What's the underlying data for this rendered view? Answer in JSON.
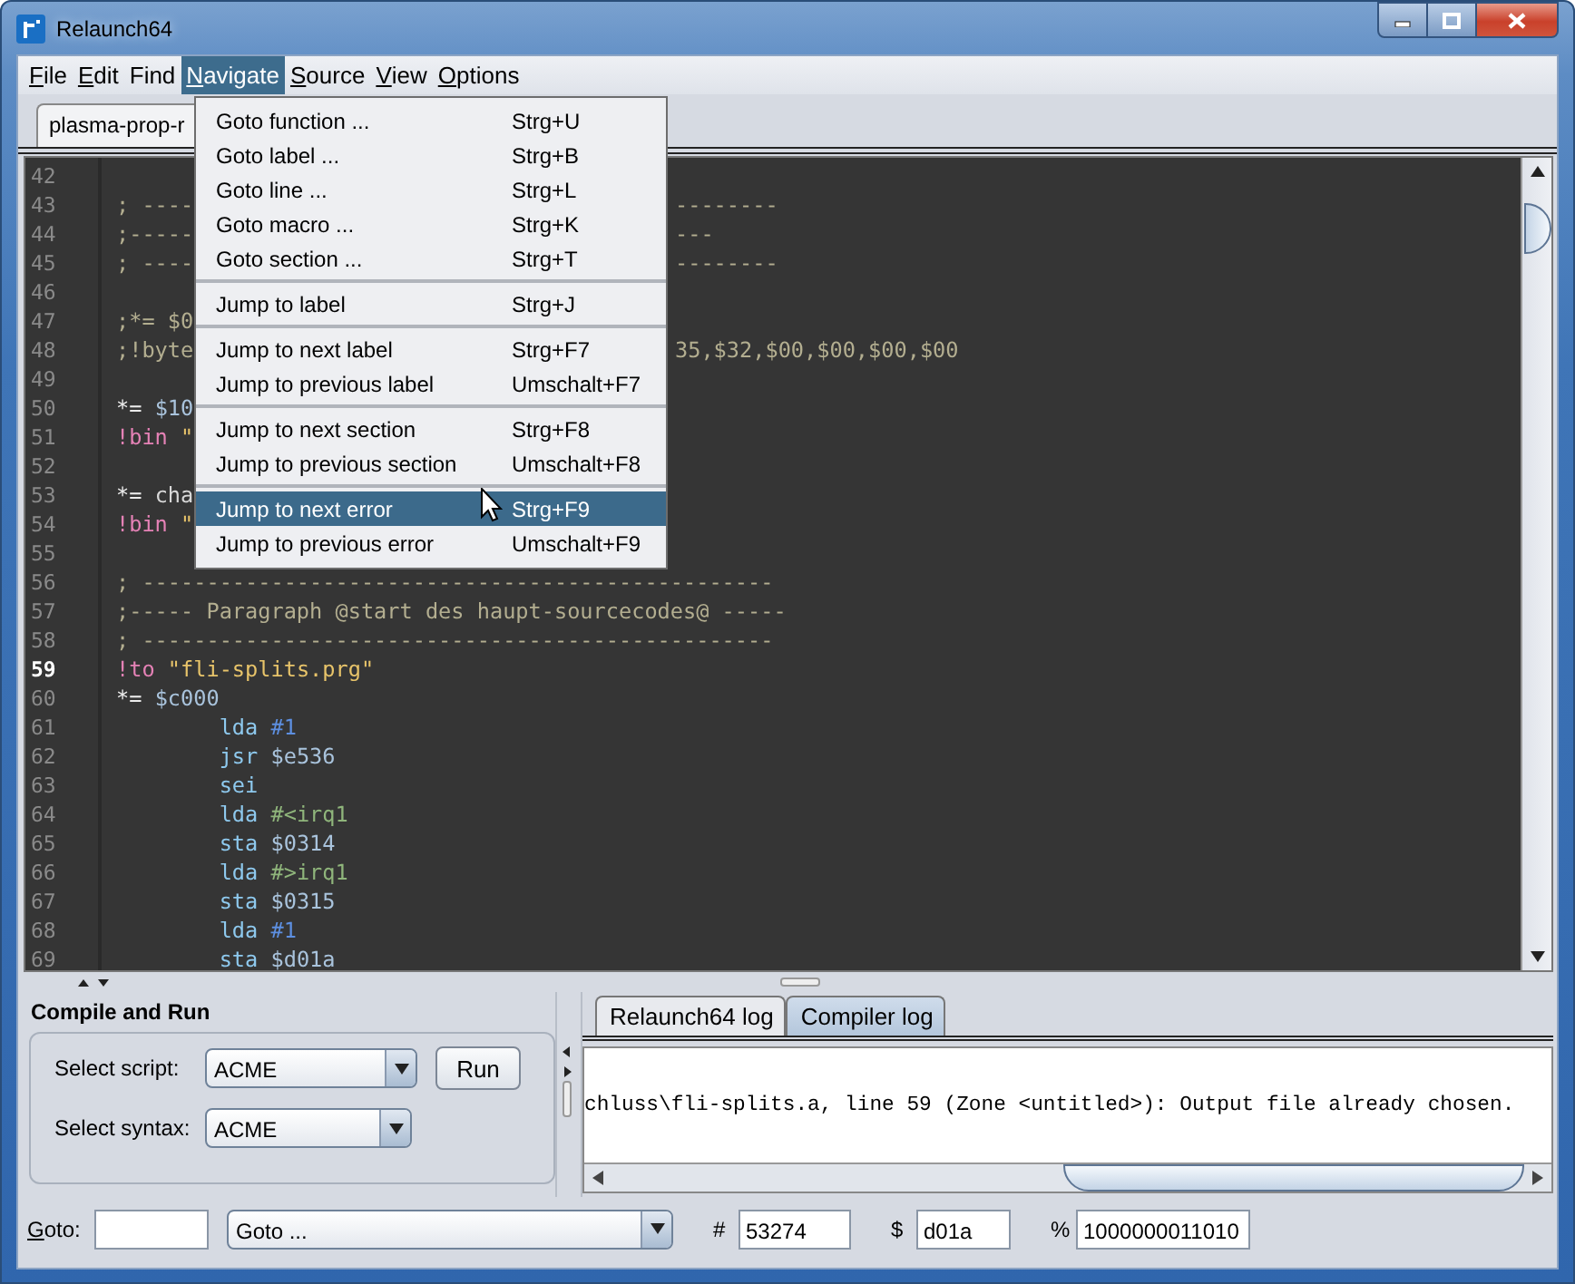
{
  "window": {
    "title": "Relaunch64"
  },
  "menu_bar": [
    {
      "label": "File",
      "first_letter_underlined": true,
      "selected": false
    },
    {
      "label": "Edit",
      "first_letter_underlined": true,
      "selected": false
    },
    {
      "label": "Find",
      "first_letter_underlined": false,
      "selected": false
    },
    {
      "label": "Navigate",
      "first_letter_underlined": true,
      "selected": true
    },
    {
      "label": "Source",
      "first_letter_underlined": true,
      "selected": false
    },
    {
      "label": "View",
      "first_letter_underlined": true,
      "selected": false
    },
    {
      "label": "Options",
      "first_letter_underlined": true,
      "selected": false
    }
  ],
  "open_menu": {
    "items": [
      {
        "kind": "item",
        "label": "Goto function ...",
        "shortcut": "Strg+U",
        "selected": false
      },
      {
        "kind": "item",
        "label": "Goto label ...",
        "shortcut": "Strg+B",
        "selected": false
      },
      {
        "kind": "item",
        "label": "Goto line ...",
        "shortcut": "Strg+L",
        "selected": false
      },
      {
        "kind": "item",
        "label": "Goto macro ...",
        "shortcut": "Strg+K",
        "selected": false
      },
      {
        "kind": "item",
        "label": "Goto section ...",
        "shortcut": "Strg+T",
        "selected": false
      },
      {
        "kind": "separator"
      },
      {
        "kind": "item",
        "label": "Jump to label",
        "shortcut": "Strg+J",
        "selected": false
      },
      {
        "kind": "separator"
      },
      {
        "kind": "item",
        "label": "Jump to next label",
        "shortcut": "Strg+F7",
        "selected": false
      },
      {
        "kind": "item",
        "label": "Jump to previous label",
        "shortcut": "Umschalt+F7",
        "selected": false
      },
      {
        "kind": "separator"
      },
      {
        "kind": "item",
        "label": "Jump to next section",
        "shortcut": "Strg+F8",
        "selected": false
      },
      {
        "kind": "item",
        "label": "Jump to previous section",
        "shortcut": "Umschalt+F8",
        "selected": false
      },
      {
        "kind": "separator"
      },
      {
        "kind": "item",
        "label": "Jump to next error",
        "shortcut": "Strg+F9",
        "selected": true
      },
      {
        "kind": "item",
        "label": "Jump to previous error",
        "shortcut": "Umschalt+F9",
        "selected": false
      }
    ]
  },
  "editor_tabs": [
    {
      "label": "plasma-prop-r"
    }
  ],
  "editor": {
    "lines": [
      {
        "number": "42",
        "current": false
      },
      {
        "number": "43",
        "current": false,
        "tokens": [
          {
            "kind": "comment",
            "text": "; ----"
          }
        ],
        "right": [
          {
            "kind": "comment",
            "text": "--------"
          }
        ]
      },
      {
        "number": "44",
        "current": false,
        "tokens": [
          {
            "kind": "comment",
            "text": ";-----"
          }
        ],
        "right": [
          {
            "kind": "comment",
            "text": "---"
          }
        ]
      },
      {
        "number": "45",
        "current": false,
        "tokens": [
          {
            "kind": "comment",
            "text": "; ----"
          }
        ],
        "right": [
          {
            "kind": "comment",
            "text": "--------"
          }
        ]
      },
      {
        "number": "46",
        "current": false
      },
      {
        "number": "47",
        "current": false,
        "tokens": [
          {
            "kind": "comment",
            "text": ";*= $0"
          }
        ]
      },
      {
        "number": "48",
        "current": false,
        "tokens": [
          {
            "kind": "comment",
            "text": ";!byte"
          }
        ],
        "right": [
          {
            "kind": "comment",
            "text": "35,$32,$00,$00,$00,$00"
          }
        ]
      },
      {
        "number": "49",
        "current": false
      },
      {
        "number": "50",
        "current": false,
        "tokens": [
          {
            "kind": "operator",
            "text": "*="
          },
          {
            "kind": "address",
            "text": " $10"
          }
        ]
      },
      {
        "number": "51",
        "current": false,
        "tokens": [
          {
            "kind": "directive",
            "text": "!bin"
          },
          {
            "kind": "string",
            "text": " \""
          }
        ]
      },
      {
        "number": "52",
        "current": false
      },
      {
        "number": "53",
        "current": false,
        "tokens": [
          {
            "kind": "operator",
            "text": "*="
          },
          {
            "kind": "plain",
            "text": " cha"
          }
        ]
      },
      {
        "number": "54",
        "current": false,
        "tokens": [
          {
            "kind": "directive",
            "text": "!bin"
          },
          {
            "kind": "string",
            "text": " \""
          }
        ]
      },
      {
        "number": "55",
        "current": false
      },
      {
        "number": "56",
        "current": false,
        "tokens": [
          {
            "kind": "comment",
            "text": "; -------------------------------------------------"
          }
        ]
      },
      {
        "number": "57",
        "current": false,
        "tokens": [
          {
            "kind": "comment",
            "text": ";----- Paragraph @start des haupt-sourcecodes@ -----"
          }
        ]
      },
      {
        "number": "58",
        "current": false,
        "tokens": [
          {
            "kind": "comment",
            "text": "; -------------------------------------------------"
          }
        ]
      },
      {
        "number": "59",
        "current": true,
        "tokens": [
          {
            "kind": "directive",
            "text": "!to"
          },
          {
            "kind": "string",
            "text": " \"fli-splits.prg\""
          }
        ]
      },
      {
        "number": "60",
        "current": false,
        "tokens": [
          {
            "kind": "operator",
            "text": "*="
          },
          {
            "kind": "address",
            "text": " $c000"
          }
        ]
      },
      {
        "number": "61",
        "current": false,
        "tokens": [
          {
            "kind": "mnemonic",
            "text": "        lda"
          },
          {
            "kind": "immediate",
            "text": " #1"
          }
        ]
      },
      {
        "number": "62",
        "current": false,
        "tokens": [
          {
            "kind": "mnemonic",
            "text": "        jsr"
          },
          {
            "kind": "address",
            "text": " $e536"
          }
        ]
      },
      {
        "number": "63",
        "current": false,
        "tokens": [
          {
            "kind": "mnemonic",
            "text": "        sei"
          }
        ]
      },
      {
        "number": "64",
        "current": false,
        "tokens": [
          {
            "kind": "mnemonic",
            "text": "        lda"
          },
          {
            "kind": "label",
            "text": " #<irq1"
          }
        ]
      },
      {
        "number": "65",
        "current": false,
        "tokens": [
          {
            "kind": "mnemonic",
            "text": "        sta"
          },
          {
            "kind": "address",
            "text": " $0314"
          }
        ]
      },
      {
        "number": "66",
        "current": false,
        "tokens": [
          {
            "kind": "mnemonic",
            "text": "        lda"
          },
          {
            "kind": "label",
            "text": " #>irq1"
          }
        ]
      },
      {
        "number": "67",
        "current": false,
        "tokens": [
          {
            "kind": "mnemonic",
            "text": "        sta"
          },
          {
            "kind": "address",
            "text": " $0315"
          }
        ]
      },
      {
        "number": "68",
        "current": false,
        "tokens": [
          {
            "kind": "mnemonic",
            "text": "        lda"
          },
          {
            "kind": "immediate",
            "text": " #1"
          }
        ]
      },
      {
        "number": "69",
        "current": false,
        "tokens": [
          {
            "kind": "mnemonic",
            "text": "        sta"
          },
          {
            "kind": "address",
            "text": " $d01a"
          }
        ]
      }
    ]
  },
  "compile_panel": {
    "title": "Compile and Run",
    "script_label": "Select script:",
    "script_value": "ACME",
    "run_button": "Run",
    "syntax_label": "Select syntax:",
    "syntax_value": "ACME"
  },
  "log_tabs": [
    {
      "label": "Relaunch64 log",
      "selected": false
    },
    {
      "label": "Compiler log",
      "selected": true
    }
  ],
  "log_text": "chluss\\fli-splits.a, line 59 (Zone <untitled>): Output file already chosen.",
  "goto_bar": {
    "label": "Goto:",
    "first_letter_underlined": true,
    "combo": "Goto ...",
    "dec_label": "#",
    "dec_value": "53274",
    "hex_label": "$",
    "hex_value": "d01a",
    "bin_label": "%",
    "bin_value": "1000000011010"
  }
}
